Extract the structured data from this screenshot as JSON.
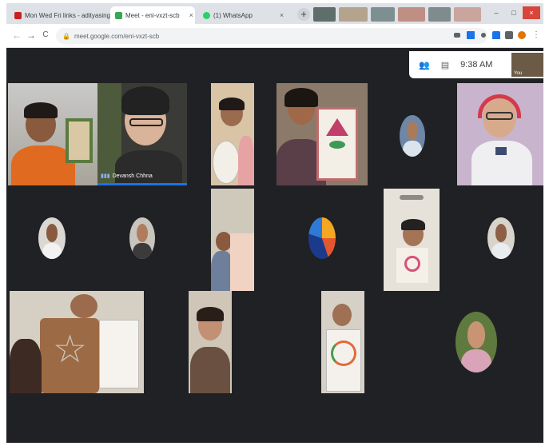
{
  "browser": {
    "tabs": [
      {
        "label": "Mon Wed Fri links - adityasing",
        "close": "×"
      },
      {
        "label": "Meet - eni-vxzt-scb",
        "close": "×"
      },
      {
        "label": "(1) WhatsApp",
        "close": "×"
      }
    ],
    "new_tab": "+",
    "window_controls": {
      "minimize": "–",
      "maximize": "□",
      "close": "×"
    },
    "nav": {
      "back": "←",
      "forward": "→",
      "reload": "C"
    },
    "url": "meet.google.com/eni-vxzt-scb",
    "lock": "🔒"
  },
  "meet": {
    "time": "9:38 AM",
    "you_label": "You",
    "participants_icon": "people-icon",
    "chat_icon": "chat-icon",
    "speaker_name": "Devansh Chhna"
  },
  "colors": {
    "stage": "#202124",
    "accent": "#1a73e8"
  }
}
